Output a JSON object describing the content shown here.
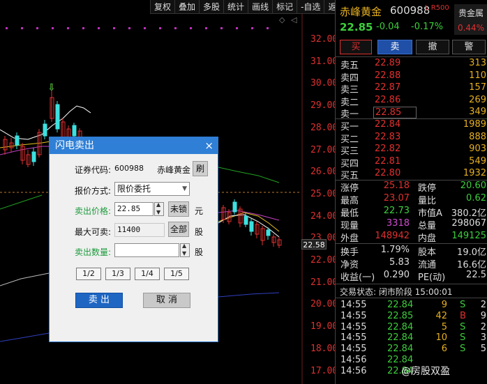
{
  "toolbar": [
    "复权",
    "叠加",
    "多股",
    "统计",
    "画线",
    "标记",
    "-自选",
    "返回"
  ],
  "price_axis": [
    "32.00",
    "31.00",
    "30.00",
    "29.00",
    "28.00",
    "27.00",
    "26.00",
    "25.00",
    "24.00",
    "23.00",
    "22.00",
    "21.00",
    "20.00",
    "19.00",
    "18.00",
    "17.00"
  ],
  "current_price_tag": "22.58",
  "colors": {
    "up": "#e03030",
    "down": "#3ccf3c",
    "accent": "#e6b020",
    "dialog_title": "#2f7fd6",
    "panel_bg": "#000000"
  },
  "dialog": {
    "title": "闪电卖出",
    "close": "×",
    "code_label": "证券代码:",
    "code_value": "600988",
    "stock_name": "赤峰黄金",
    "refresh": "刷",
    "price_mode_label": "报价方式:",
    "price_mode_value": "限价委托",
    "sell_price_label": "卖出价格:",
    "sell_price_value": "22.85",
    "unlock": "未锁",
    "yuan": "元",
    "max_label": "最大可卖:",
    "max_value": "11400",
    "all": "全部",
    "gu1": "股",
    "qty_label": "卖出数量:",
    "qty_value": "",
    "gu2": "股",
    "fractions": [
      "1/2",
      "1/3",
      "1/4",
      "1/5"
    ],
    "sell_button": "卖 出",
    "cancel_button": "取 消"
  },
  "quote": {
    "name": "赤峰黄金",
    "code": "600988",
    "flags": "L R500",
    "sector": "贵金属",
    "sector_pct": "0.44%",
    "price": "22.85",
    "change": "-0.04",
    "change_pct": "-0.17%",
    "buttons": [
      "买",
      "卖",
      "撤",
      "警"
    ]
  },
  "order_book": {
    "asks": [
      {
        "label": "卖五",
        "price": "22.89",
        "vol": "313"
      },
      {
        "label": "卖四",
        "price": "22.88",
        "vol": "110"
      },
      {
        "label": "卖三",
        "price": "22.87",
        "vol": "157"
      },
      {
        "label": "卖二",
        "price": "22.86",
        "vol": "269"
      },
      {
        "label": "卖一",
        "price": "22.85",
        "vol": "349"
      }
    ],
    "bids": [
      {
        "label": "买一",
        "price": "22.84",
        "vol": "1989"
      },
      {
        "label": "买二",
        "price": "22.83",
        "vol": "888"
      },
      {
        "label": "买三",
        "price": "22.82",
        "vol": "903"
      },
      {
        "label": "买四",
        "price": "22.81",
        "vol": "549"
      },
      {
        "label": "买五",
        "price": "22.80",
        "vol": "1932"
      }
    ]
  },
  "stats": [
    {
      "l1": "涨停",
      "v1": "25.18",
      "c1": "red",
      "l2": "跌停",
      "v2": "20.60",
      "c2": "green"
    },
    {
      "l1": "最高",
      "v1": "23.07",
      "c1": "red",
      "l2": "量比",
      "v2": "0.62",
      "c2": "green"
    },
    {
      "l1": "最低",
      "v1": "22.73",
      "c1": "green",
      "l2": "市值A",
      "v2": "380.2亿",
      "c2": "white"
    },
    {
      "l1": "现量",
      "v1": "3318",
      "c1": "purple",
      "l2": "总量",
      "v2": "298067",
      "c2": "white"
    },
    {
      "l1": "外盘",
      "v1": "148942",
      "c1": "red",
      "l2": "内盘",
      "v2": "149125",
      "c2": "green"
    }
  ],
  "stats2": [
    {
      "l1": "换手",
      "v1": "1.79%",
      "c1": "white",
      "l2": "股本",
      "v2": "19.0亿",
      "c2": "white"
    },
    {
      "l1": "净资",
      "v1": "5.83",
      "c1": "white",
      "l2": "流通",
      "v2": "16.6亿",
      "c2": "white"
    },
    {
      "l1": "收益(一)",
      "v1": "0.290",
      "c1": "white",
      "l2": "PE(动)",
      "v2": "22.5",
      "c2": "white"
    }
  ],
  "trade_status": "交易状态: 闭市阶段 15:00:01",
  "ticks": [
    {
      "time": "14:55",
      "price": "22.84",
      "vol": "9",
      "side": "S",
      "n": "2"
    },
    {
      "time": "14:55",
      "price": "22.85",
      "vol": "42",
      "side": "B",
      "n": "9"
    },
    {
      "time": "14:55",
      "price": "22.84",
      "vol": "5",
      "side": "S",
      "n": "2"
    },
    {
      "time": "14:55",
      "price": "22.84",
      "vol": "10",
      "side": "S",
      "n": "3"
    },
    {
      "time": "14:55",
      "price": "22.84",
      "vol": "6",
      "side": "S",
      "n": "5"
    },
    {
      "time": "14:56",
      "price": "22.84",
      "vol": "",
      "side": "",
      "n": ""
    },
    {
      "time": "14:56",
      "price": "22.84",
      "vol": "",
      "side": "",
      "n": ""
    }
  ],
  "watermark": "@房股双盈"
}
